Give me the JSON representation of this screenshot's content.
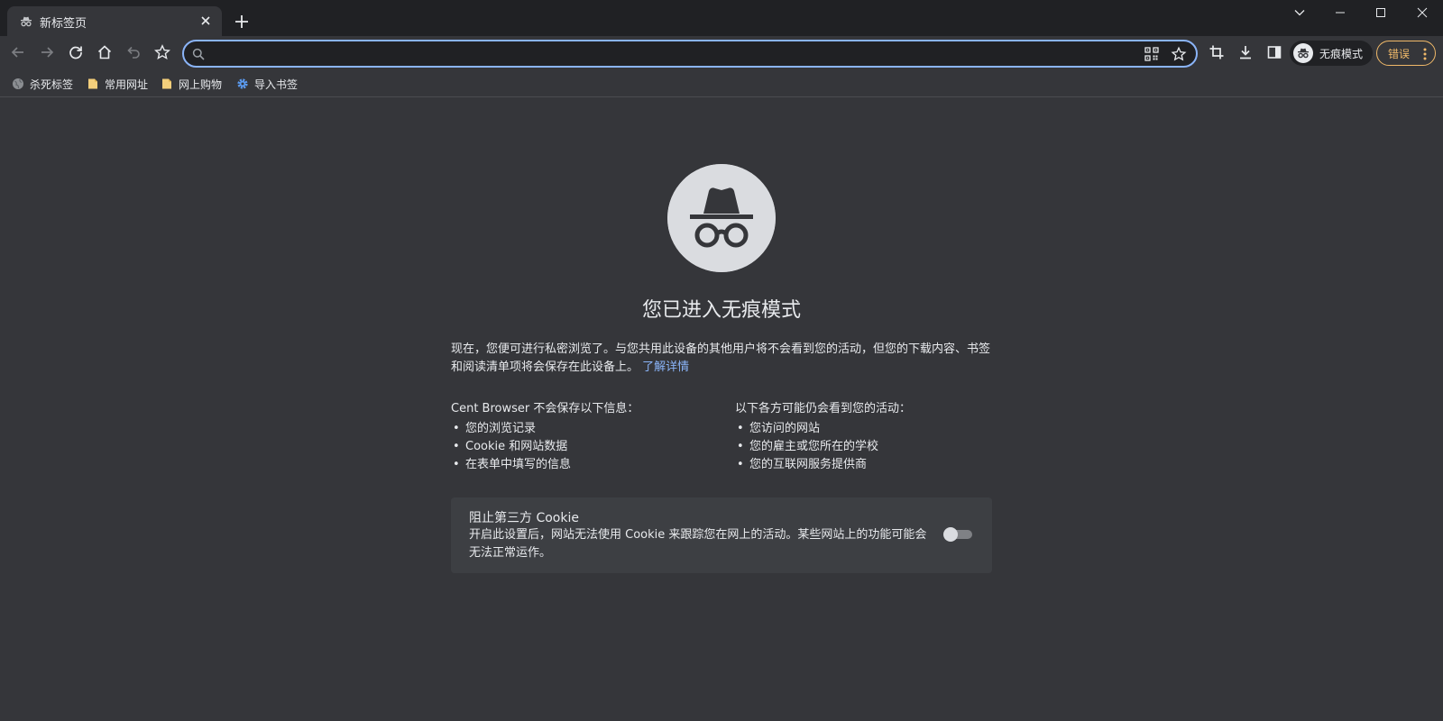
{
  "tab": {
    "title": "新标签页"
  },
  "omnibox": {
    "value": "",
    "placeholder": ""
  },
  "profile": {
    "label": "无痕模式"
  },
  "error_button": {
    "label": "错误"
  },
  "bookmarks": [
    {
      "label": "杀死标签",
      "icon": "globe-icon"
    },
    {
      "label": "常用网址",
      "icon": "folder-icon"
    },
    {
      "label": "网上购物",
      "icon": "folder-icon"
    },
    {
      "label": "导入书签",
      "icon": "gear-icon"
    }
  ],
  "incognito": {
    "title": "您已进入无痕模式",
    "intro_text": "现在，您便可进行私密浏览了。与您共用此设备的其他用户将不会看到您的活动，但您的下载内容、书签和阅读清单项将会保存在此设备上。",
    "learn_more": "了解详情",
    "not_saved_heading": "Cent Browser 不会保存以下信息：",
    "not_saved_items": [
      "您的浏览记录",
      "Cookie 和网站数据",
      "在表单中填写的信息"
    ],
    "visible_heading": "以下各方可能仍会看到您的活动：",
    "visible_items": [
      "您访问的网站",
      "您的雇主或您所在的学校",
      "您的互联网服务提供商"
    ]
  },
  "cookie_card": {
    "title": "阻止第三方 Cookie",
    "description": "开启此设置后，网站无法使用 Cookie 来跟踪您在网上的活动。某些网站上的功能可能会无法正常运作。",
    "enabled": false
  },
  "colors": {
    "accent": "#8ab4f8",
    "error": "#f0b969",
    "background": "#35363a"
  }
}
